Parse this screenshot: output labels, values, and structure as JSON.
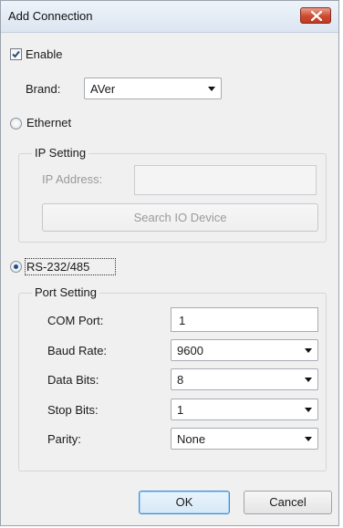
{
  "window": {
    "title": "Add Connection"
  },
  "enable": {
    "label": "Enable",
    "checked": true
  },
  "brand": {
    "label": "Brand:",
    "value": "AVer"
  },
  "ethernet": {
    "label": "Ethernet",
    "selected": false,
    "ip_setting": {
      "title": "IP Setting",
      "ip_address_label": "IP Address:",
      "ip_address_value": "",
      "search_button": "Search IO Device"
    }
  },
  "serial": {
    "label": "RS-232/485",
    "selected": true,
    "port_setting": {
      "title": "Port Setting",
      "com_port_label": "COM Port:",
      "com_port_value": "1",
      "baud_rate_label": "Baud Rate:",
      "baud_rate_value": "9600",
      "data_bits_label": "Data Bits:",
      "data_bits_value": "8",
      "stop_bits_label": "Stop Bits:",
      "stop_bits_value": "1",
      "parity_label": "Parity:",
      "parity_value": "None"
    }
  },
  "buttons": {
    "ok": "OK",
    "cancel": "Cancel"
  },
  "colors": {
    "close_button": "#c8452c",
    "default_button_border": "#3c8fd6",
    "radio_dot": "#1e4e8c"
  }
}
